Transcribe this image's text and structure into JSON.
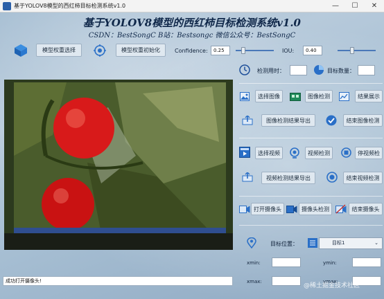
{
  "window": {
    "title": "基于YOLOV8模型的西红柿目标检测系统v1.0",
    "minimize": "—",
    "maximize": "☐",
    "close": "✕"
  },
  "header": {
    "title": "基于YOLOV8模型的西红柿目标检测系统v1.0",
    "subtitle": "CSDN：BestSongC   B站：Bestsongc   微信公众号：BestSongC"
  },
  "model": {
    "select_label": "模型权重选择",
    "init_label": "模型权重初始化"
  },
  "params": {
    "confidence_label": "Confidence:",
    "confidence_value": "0.25",
    "iou_label": "IOU:",
    "iou_value": "0.40"
  },
  "stats": {
    "time_label": "检测用时：",
    "time_value": "",
    "count_label": "目标数量：",
    "count_value": ""
  },
  "image_ops": {
    "select": "选择图像",
    "detect": "图像检测",
    "show": "结果展示",
    "export": "图像检测结果导出",
    "end": "结束图像检测"
  },
  "video_ops": {
    "select": "选择视频",
    "detect": "视频检测",
    "pause": "停视频检",
    "export": "视频检测结果导出",
    "end": "结束视频检测"
  },
  "camera_ops": {
    "open": "打开摄像头",
    "detect": "摄像头检测",
    "end": "结束摄像头"
  },
  "result": {
    "target_label": "目标位置：",
    "selected": "目标1",
    "xmin_label": "xmin:",
    "xmin_value": "",
    "ymin_label": "ymin:",
    "ymin_value": "",
    "xmax_label": "xmax:",
    "xmax_value": "",
    "ymax_label": "ymax:",
    "ymax_value": ""
  },
  "status": "成功打开摄像头!",
  "watermark": "@稀土掘金技术社区",
  "colors": {
    "accent": "#2a6fc7",
    "panel": "#dfe8f0",
    "tomato": "#d81a1a"
  }
}
